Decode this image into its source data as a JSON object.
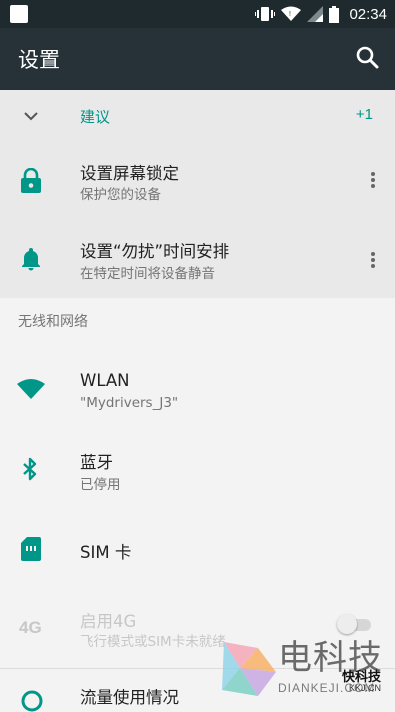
{
  "status_bar": {
    "time": "02:34",
    "icons": [
      "vibrate-icon",
      "wifi-icon",
      "signal-icon",
      "battery-icon"
    ]
  },
  "app_bar": {
    "title": "设置",
    "search_icon": "search-icon"
  },
  "suggestions": {
    "header_label": "建议",
    "count": "+1",
    "items": [
      {
        "title": "设置屏幕锁定",
        "subtitle": "保护您的设备",
        "icon": "lock-icon"
      },
      {
        "title": "设置“勿扰”时间安排",
        "subtitle": "在特定时间将设备静音",
        "icon": "bell-icon"
      }
    ]
  },
  "sections": {
    "wireless_label": "无线和网络"
  },
  "settings_items": [
    {
      "title": "WLAN",
      "subtitle": "\"Mydrivers_J3\"",
      "icon": "wifi-icon"
    },
    {
      "title": "蓝牙",
      "subtitle": "已停用",
      "icon": "bluetooth-icon"
    },
    {
      "title": "SIM 卡",
      "subtitle": "",
      "icon": "sim-card-icon"
    },
    {
      "title": "启用4G",
      "subtitle": "飞行模式或SIM卡未就绪",
      "icon_text": "4G",
      "toggle_on": false,
      "disabled": true
    },
    {
      "title": "流量使用情况",
      "subtitle": "",
      "icon": "data-usage-icon"
    }
  ],
  "watermark": {
    "main": "电科技",
    "sub": "DIANKEJI.COM",
    "brand": "快科技",
    "brand_sub": "KKJ.CN"
  },
  "colors": {
    "accent": "#009688",
    "app_bar": "#263238",
    "status_bar": "#1e2a2d",
    "suggestion_bg": "#e9e9e9",
    "background": "#f3f3f3"
  }
}
